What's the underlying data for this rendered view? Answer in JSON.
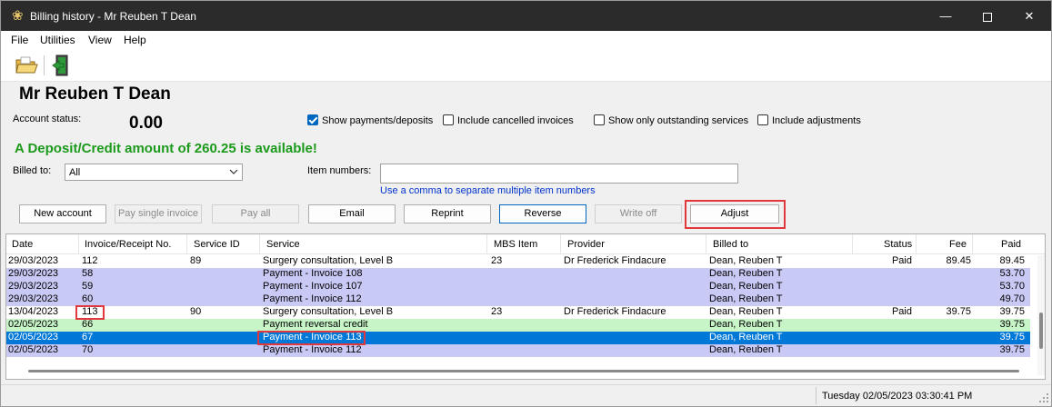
{
  "window": {
    "title": "Billing history - Mr Reuben T Dean",
    "minimize": "—",
    "close": "✕"
  },
  "menu": [
    "File",
    "Utilities",
    "View",
    "Help"
  ],
  "toolbar": {
    "icons": [
      "open-folder-icon",
      "exit-door-icon"
    ]
  },
  "patient": {
    "name": "Mr Reuben T Dean",
    "account_status_label": "Account status:",
    "account_status_value": "0.00"
  },
  "filters": {
    "show_payments": {
      "label": "Show payments/deposits",
      "checked": true
    },
    "include_cancelled": {
      "label": "Include cancelled invoices",
      "checked": false
    },
    "show_outstanding": {
      "label": "Show only outstanding services",
      "checked": false
    },
    "include_adjustments": {
      "label": "Include adjustments",
      "checked": false
    }
  },
  "deposit_message": "A Deposit/Credit amount of 260.25 is available!",
  "billed_to": {
    "label": "Billed to:",
    "value": "All"
  },
  "item_numbers": {
    "label": "Item numbers:",
    "value": "",
    "hint": "Use a comma to separate multiple item numbers"
  },
  "buttons": {
    "new_account": "New account",
    "pay_single": "Pay single invoice",
    "pay_all": "Pay all",
    "email": "Email",
    "reprint": "Reprint",
    "reverse": "Reverse",
    "write_off": "Write off",
    "adjust": "Adjust"
  },
  "table": {
    "columns": [
      "Date",
      "Invoice/Receipt No.",
      "Service ID",
      "Service",
      "MBS Item",
      "Provider",
      "Billed to",
      "Status",
      "Fee",
      "Paid"
    ],
    "rows": [
      {
        "date": "29/03/2023",
        "inv": "112",
        "sid": "89",
        "service": "Surgery consultation, Level B",
        "mbs": "23",
        "provider": "Dr Frederick Findacure",
        "billed": "Dean, Reuben T",
        "status": "Paid",
        "fee": "89.45",
        "paid": "89.45",
        "style": "white"
      },
      {
        "date": "29/03/2023",
        "inv": "58",
        "sid": "",
        "service": "Payment - Invoice 108",
        "mbs": "",
        "provider": "",
        "billed": "Dean, Reuben T",
        "status": "",
        "fee": "",
        "paid": "53.70",
        "style": "lav"
      },
      {
        "date": "29/03/2023",
        "inv": "59",
        "sid": "",
        "service": "Payment - Invoice 107",
        "mbs": "",
        "provider": "",
        "billed": "Dean, Reuben T",
        "status": "",
        "fee": "",
        "paid": "53.70",
        "style": "lav"
      },
      {
        "date": "29/03/2023",
        "inv": "60",
        "sid": "",
        "service": "Payment - Invoice 112",
        "mbs": "",
        "provider": "",
        "billed": "Dean, Reuben T",
        "status": "",
        "fee": "",
        "paid": "49.70",
        "style": "lav"
      },
      {
        "date": "13/04/2023",
        "inv": "113",
        "sid": "90",
        "service": "Surgery consultation, Level B",
        "mbs": "23",
        "provider": "Dr Frederick Findacure",
        "billed": "Dean, Reuben T",
        "status": "Paid",
        "fee": "39.75",
        "paid": "39.75",
        "style": "white"
      },
      {
        "date": "02/05/2023",
        "inv": "66",
        "sid": "",
        "service": "Payment reversal credit",
        "mbs": "",
        "provider": "",
        "billed": "Dean, Reuben T",
        "status": "",
        "fee": "",
        "paid": "39.75",
        "style": "green"
      },
      {
        "date": "02/05/2023",
        "inv": "67",
        "sid": "",
        "service": "Payment - Invoice 113",
        "mbs": "",
        "provider": "",
        "billed": "Dean, Reuben T",
        "status": "",
        "fee": "",
        "paid": "39.75",
        "style": "sel"
      },
      {
        "date": "02/05/2023",
        "inv": "70",
        "sid": "",
        "service": "Payment - Invoice 112",
        "mbs": "",
        "provider": "",
        "billed": "Dean, Reuben T",
        "status": "",
        "fee": "",
        "paid": "39.75",
        "style": "lav"
      }
    ]
  },
  "status_bar": {
    "datetime": "Tuesday 02/05/2023 03:30:41 PM"
  },
  "colors": {
    "title_bar": "#2b2b2b",
    "deposit_text": "#1c9a1c",
    "hint_text": "#0033cc",
    "selected_row": "#0078d7",
    "payment_row": "#c9c9f5",
    "reversal_row": "#c8f5c8",
    "highlight_box": "#e0383c"
  }
}
